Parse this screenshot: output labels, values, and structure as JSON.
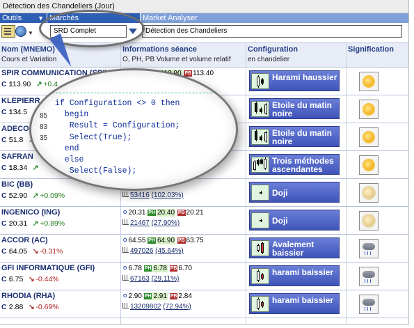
{
  "window": {
    "title": "Détection des Chandeliers (Jour)"
  },
  "toolbar": {
    "outils_label": "Outils",
    "marches_label": "Marchés",
    "analyser_label": "Market Analyser",
    "market_value": "SRD Complet",
    "analyser_value": "Détection des Chandeliers"
  },
  "columns": {
    "name_title": "Nom (MNEMO)",
    "name_sub": "Cours et Variation",
    "info_title": "Informations séance",
    "info_sub": "O, PH, PB Volume et volume relatif",
    "config_title": "Configuration",
    "config_sub": "en chandelier",
    "sig_title": "Signification"
  },
  "tags": {
    "o": "O",
    "ph": "PH",
    "pb": "PB",
    "c": "C :"
  },
  "rows": [
    {
      "name": "SPIR COMMUNICATION (SPI)",
      "cours": "113.90",
      "var": "+0.4",
      "dir": "up",
      "o": "113.40",
      "ph": "113.90",
      "pb": "113.40",
      "vol": "",
      "volrel": "",
      "config": "Harami haussier",
      "sig": "sun"
    },
    {
      "name": "KLEPIERR",
      "cours": "134.5",
      "var": "",
      "dir": "up",
      "o": "",
      "ph": "",
      "pb": "3.70",
      "vol": "",
      "volrel": "",
      "config": "Etoile du matin noire",
      "sig": "sun"
    },
    {
      "name": "ADECO",
      "cours": "51.8",
      "var": "",
      "dir": "up",
      "o": "",
      "ph": "",
      "pb": "",
      "vol": "",
      "volrel": "",
      "config": "Etoile du matin noire",
      "sig": "sun"
    },
    {
      "name": "SAFRAN",
      "cours": "18.34",
      "var": "",
      "dir": "up",
      "o": "",
      "ph": "",
      "pb": "",
      "vol": "",
      "volrel": "",
      "config": "Trois méthodes ascendantes",
      "sig": "sun"
    },
    {
      "name": "BIC (BB)",
      "cours": "52.90",
      "var": "+0.09%",
      "dir": "up",
      "o": "",
      "ph": "",
      "pb": "52.85",
      "vol": "53416",
      "volrel": "(102.03%)",
      "config": "Doji",
      "sig": "cloudsun"
    },
    {
      "name": "INGENICO (ING)",
      "cours": "20.31",
      "var": "+0.89%",
      "dir": "up",
      "o": "20.31",
      "ph": "20.40",
      "pb": "20.21",
      "vol": "21467",
      "volrel": "(27.90%)",
      "config": "Doji",
      "sig": "cloudsun"
    },
    {
      "name": "ACCOR (AC)",
      "cours": "64.05",
      "var": "-0.31%",
      "dir": "dn",
      "o": "64.55",
      "ph": "64.90",
      "pb": "63.75",
      "vol": "497026",
      "volrel": "(45.64%)",
      "config": "Avalement baissier",
      "sig": "rain"
    },
    {
      "name": "GFI INFORMATIQUE (GFI)",
      "cours": "6.75",
      "var": "-0.44%",
      "dir": "dn",
      "o": "6.78",
      "ph": "6.78",
      "pb": "6.70",
      "vol": "67163",
      "volrel": "(29.11%)",
      "config": "harami baissier",
      "sig": "rain"
    },
    {
      "name": "RHODIA (RHA)",
      "cours": "2.88",
      "var": "-0.69%",
      "dir": "dn",
      "o": "2.90",
      "ph": "2.91",
      "pb": "2.84",
      "vol": "13209802",
      "volrel": "(72.94%)",
      "config": "harami baissier",
      "sig": "rain"
    }
  ],
  "magnifier": {
    "code_lines": [
      "if Configuration <> 0 then",
      "  begin",
      "   Result = Configuration;",
      "   Select(True);",
      "  end",
      "  else",
      "   Select(False);"
    ],
    "side_digits": [
      "85",
      "83",
      "35"
    ]
  }
}
